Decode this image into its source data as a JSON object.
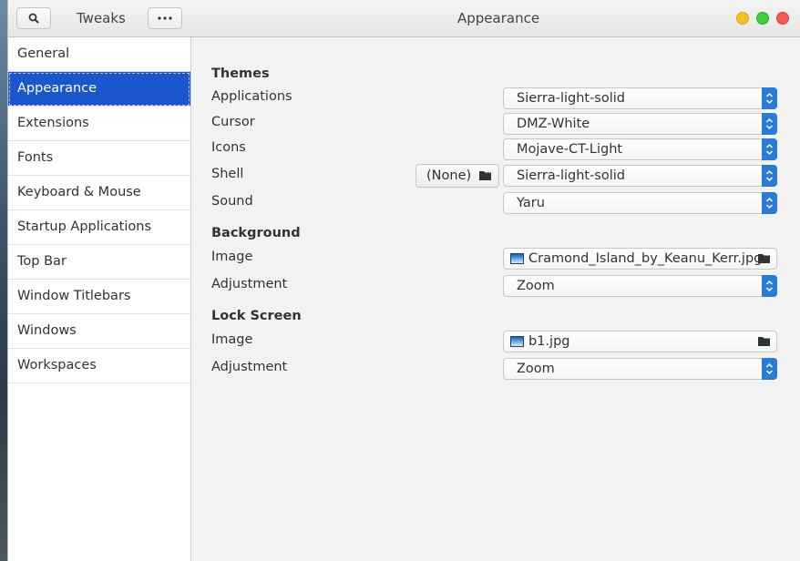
{
  "titlebar": {
    "app_title": "Tweaks",
    "page_title": "Appearance",
    "search_icon": "search-icon",
    "menu_icon": "ellipsis-icon"
  },
  "sidebar": {
    "items": [
      {
        "label": "General"
      },
      {
        "label": "Appearance",
        "active": true
      },
      {
        "label": "Extensions"
      },
      {
        "label": "Fonts"
      },
      {
        "label": "Keyboard & Mouse"
      },
      {
        "label": "Startup Applications"
      },
      {
        "label": "Top Bar"
      },
      {
        "label": "Window Titlebars"
      },
      {
        "label": "Windows"
      },
      {
        "label": "Workspaces"
      }
    ]
  },
  "themes": {
    "heading": "Themes",
    "applications": {
      "label": "Applications",
      "value": "Sierra-light-solid"
    },
    "cursor": {
      "label": "Cursor",
      "value": "DMZ-White"
    },
    "icons": {
      "label": "Icons",
      "value": "Mojave-CT-Light"
    },
    "shell": {
      "label": "Shell",
      "none_button": "(None)",
      "value": "Sierra-light-solid"
    },
    "sound": {
      "label": "Sound",
      "value": "Yaru"
    }
  },
  "background": {
    "heading": "Background",
    "image": {
      "label": "Image",
      "file": "Cramond_Island_by_Keanu_Kerr.jpg"
    },
    "adjustment": {
      "label": "Adjustment",
      "value": "Zoom"
    }
  },
  "lock_screen": {
    "heading": "Lock Screen",
    "image": {
      "label": "Image",
      "file": "b1.jpg"
    },
    "adjustment": {
      "label": "Adjustment",
      "value": "Zoom"
    }
  },
  "colors": {
    "accent": "#1a57cf",
    "combo_arrow": "#2a7ad9",
    "minimize": "#f5c022",
    "maximize": "#3ecf3e",
    "close": "#f25a55"
  }
}
